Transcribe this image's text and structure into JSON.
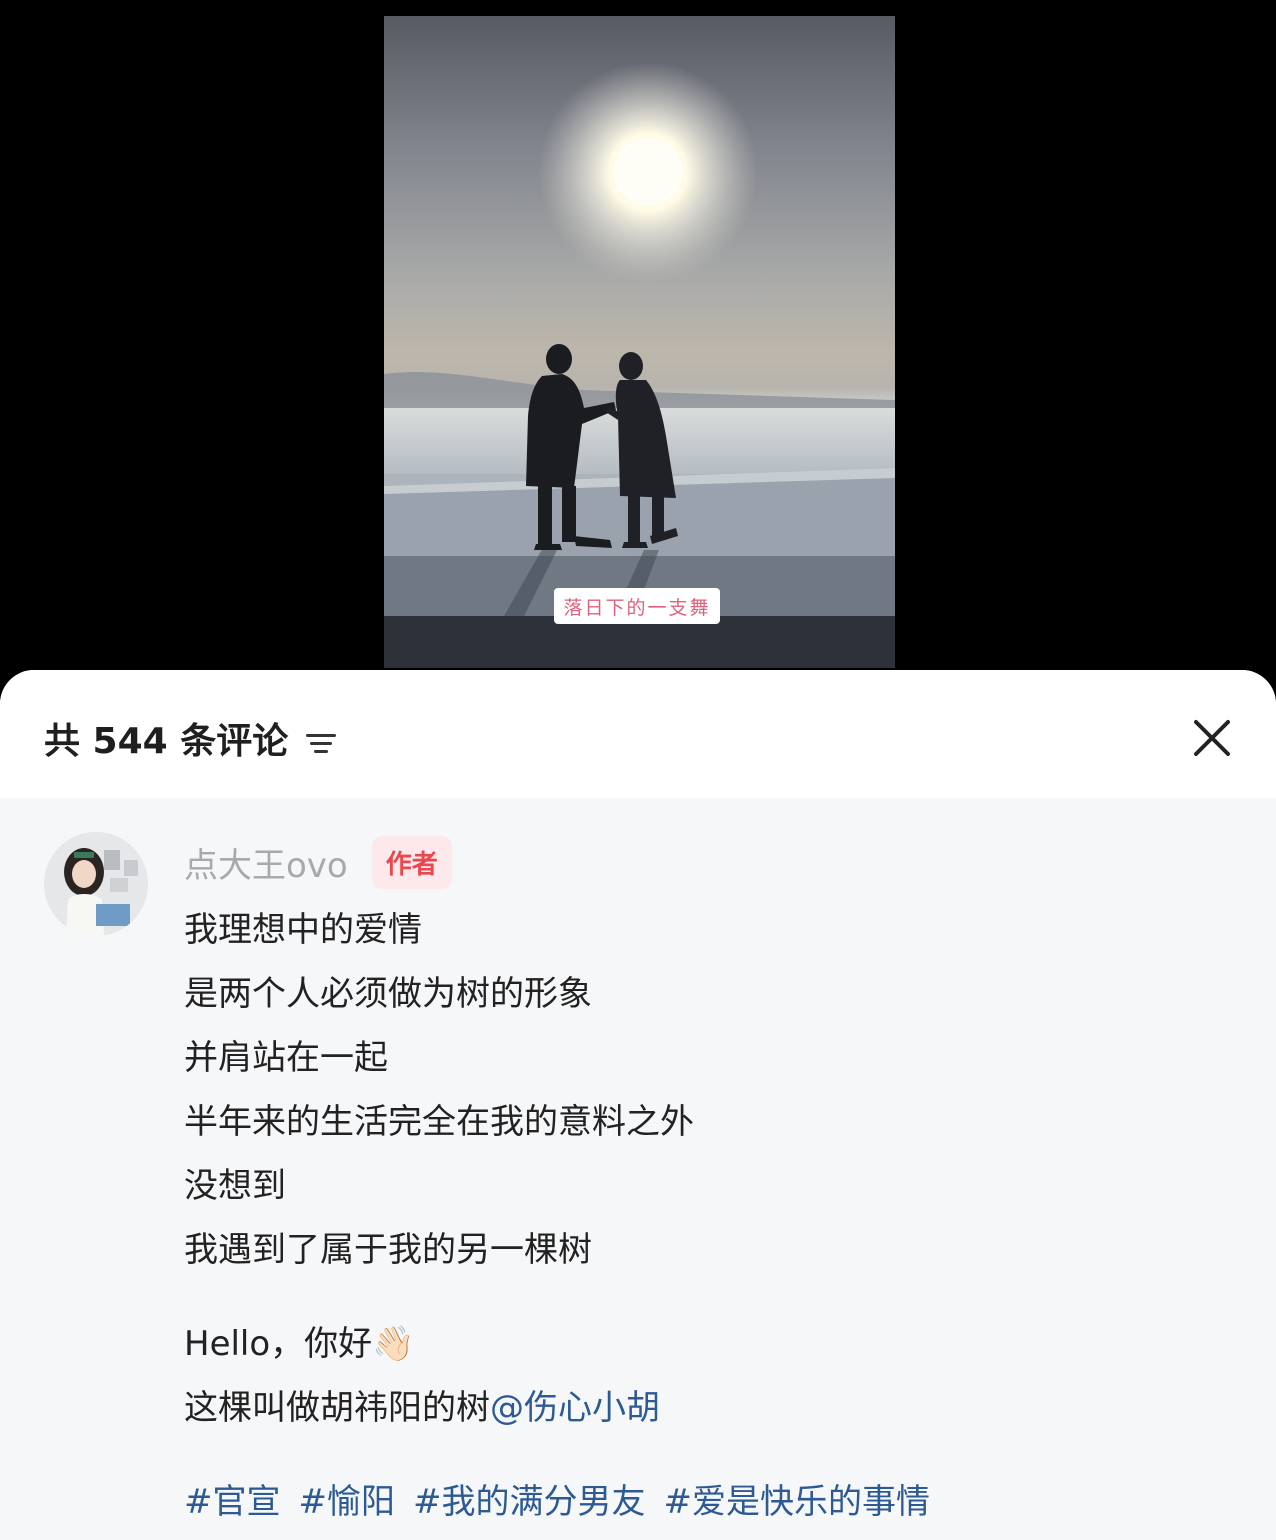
{
  "video": {
    "caption": "落日下的一支舞"
  },
  "comments_panel": {
    "count_label": "共 544 条评论",
    "sort_icon": "sort-filter-icon",
    "close_icon": "close-icon"
  },
  "comment": {
    "author": "点大王ovo",
    "author_badge": "作者",
    "avatar_icon": "avatar-photo",
    "lines": [
      "我理想中的爱情",
      "是两个人必须做为树的形象",
      "并肩站在一起",
      "半年来的生活完全在我的意料之外",
      "没想到",
      "我遇到了属于我的另一棵树"
    ],
    "greeting": "Hello，你好",
    "greeting_emoji": "👋🏻",
    "tree_line": "这棵叫做胡祎阳的树",
    "mention": "@伤心小胡",
    "hashtags": [
      "#官宣",
      "#愉阳",
      "#我的满分男友",
      "#爱是快乐的事情"
    ]
  },
  "colors": {
    "link_blue": "#2e5a93",
    "author_badge_red": "#e8484e",
    "sheet_bg": "#f6f7f9"
  }
}
